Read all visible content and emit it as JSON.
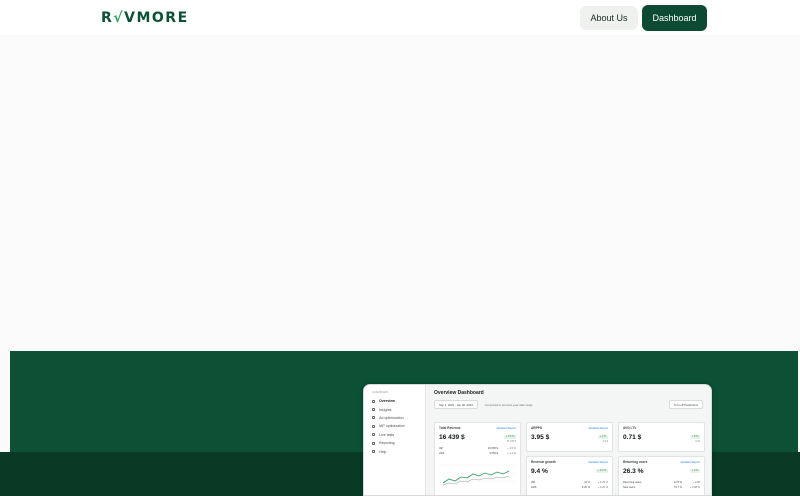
{
  "header": {
    "logo_text": "REVMORE",
    "about_label": "About Us",
    "dashboard_label": "Dashboard"
  },
  "colors": {
    "brand_green": "#0c5135",
    "brand_dark": "#083a26",
    "accent_light": "#eef1ee"
  },
  "dashboard": {
    "title": "Overview Dashboard",
    "date_range": "Sep 1, 2022 - Jan 30, 2023",
    "compare_text": "Compared to previous year date range",
    "turn_off_label": "Turn off Predictions",
    "sidebar": {
      "heading": "DASHBOARD",
      "items": [
        {
          "label": "Overview",
          "icon": "grid-icon"
        },
        {
          "label": "Insights",
          "icon": "chart-icon"
        },
        {
          "label": "Ad optimization",
          "icon": "target-icon"
        },
        {
          "label": "IAP optimization",
          "icon": "cart-icon"
        },
        {
          "label": "Live tests",
          "icon": "flask-icon"
        },
        {
          "label": "Reporting",
          "icon": "report-icon"
        },
        {
          "label": "Help",
          "icon": "help-icon"
        }
      ]
    },
    "cards": {
      "total_revenue": {
        "label": "Total Revenue",
        "link": "Detailed Report",
        "value": "16 439 $",
        "badge": "+ 2.5 %",
        "sub": "15 235 $",
        "rows": [
          {
            "name": "IAP",
            "value": "16 065 $",
            "delta": "+ 1.5 %"
          },
          {
            "name": "ADS",
            "value": "3 053 $",
            "delta": "+ 1.1 %"
          }
        ]
      },
      "arppu": {
        "label": "ARPPU",
        "link": "Detailed Report",
        "value": "3.95 $",
        "badge": "+ 4 %",
        "sub": "3.8 $"
      },
      "avg_ltv": {
        "label": "AVG LTV",
        "link": "",
        "value": "0.71 $",
        "badge": "+ 8 %",
        "sub": "0.65"
      },
      "revenue_growth": {
        "label": "Revenue growth",
        "link": "Detailed Report",
        "value": "9.4 %",
        "badge": "+ 0.2 %",
        "sub": "",
        "rows": [
          {
            "name": "IAP",
            "value": "11 %",
            "delta": "+ 0.25 %"
          },
          {
            "name": "ADS",
            "value": "5.25 %",
            "delta": "+ 0.25 %"
          }
        ]
      },
      "returning_users": {
        "label": "Returning users",
        "link": "Detailed Report",
        "value": "26.3 %",
        "badge": "+ 2 %",
        "sub": "",
        "rows": [
          {
            "name": "Recurring users",
            "value": "12.5 %",
            "delta": "+ 0.98"
          },
          {
            "name": "New users",
            "value": "73.7 %",
            "delta": "+ 0.98 %"
          }
        ]
      }
    }
  }
}
